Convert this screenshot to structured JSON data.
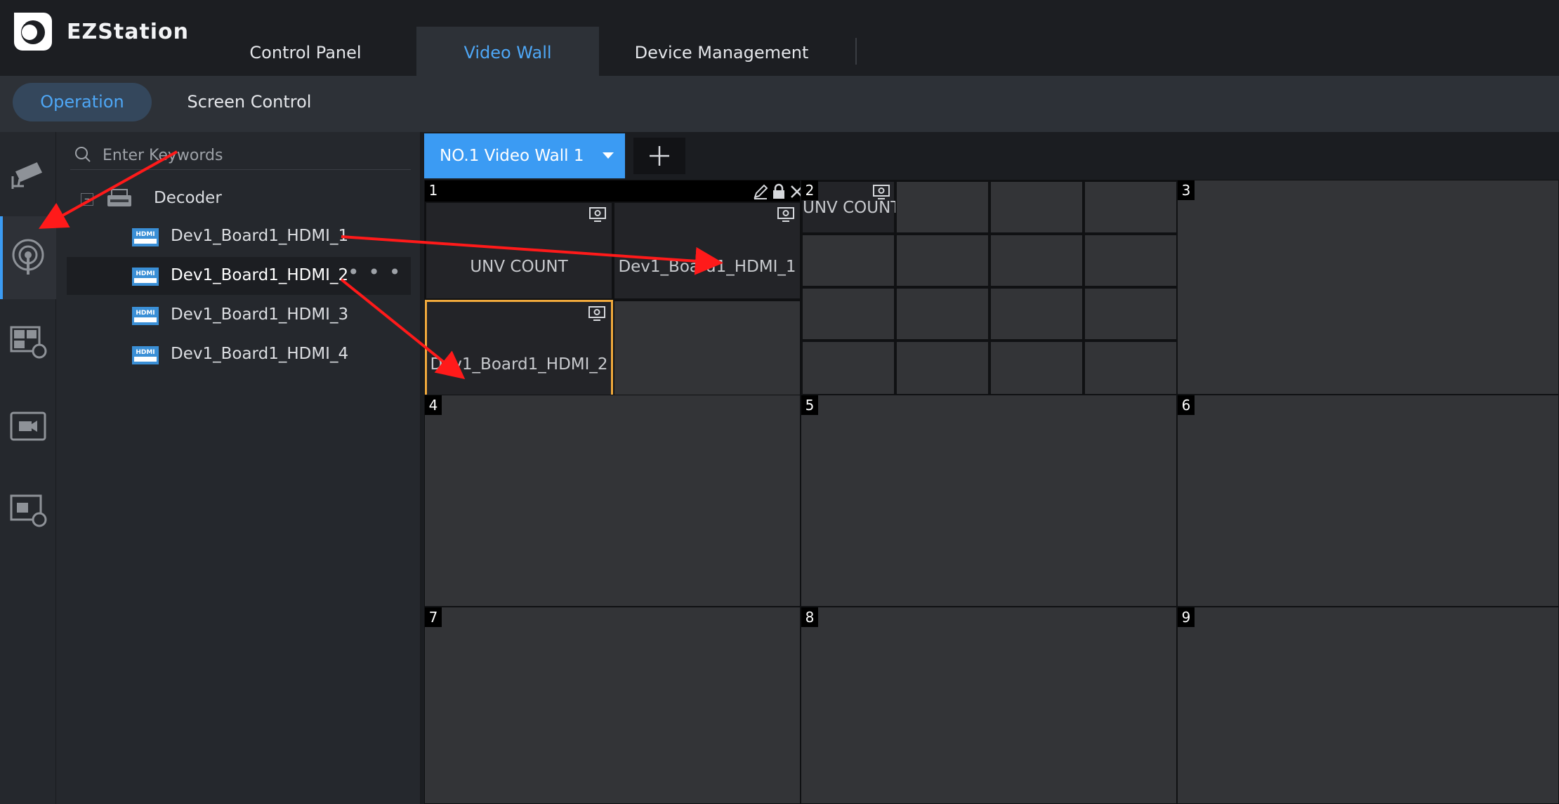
{
  "app": {
    "title": "EZStation"
  },
  "main_tabs": [
    {
      "label": "Control Panel"
    },
    {
      "label": "Video Wall"
    },
    {
      "label": "Device Management"
    }
  ],
  "sub_tabs": [
    {
      "label": "Operation"
    },
    {
      "label": "Screen Control"
    }
  ],
  "search": {
    "placeholder": "Enter Keywords"
  },
  "tree": {
    "root": {
      "label": "Decoder"
    },
    "items": [
      {
        "label": "Dev1_Board1_HDMI_1"
      },
      {
        "label": "Dev1_Board1_HDMI_2"
      },
      {
        "label": "Dev1_Board1_HDMI_3"
      },
      {
        "label": "Dev1_Board1_HDMI_4"
      }
    ],
    "more": "• • •"
  },
  "wall": {
    "tab_label": "NO.1 Video Wall 1",
    "screens": [
      "1",
      "2",
      "3",
      "4",
      "5",
      "6",
      "7",
      "8",
      "9"
    ],
    "windows": {
      "s1_w1": "UNV COUNT",
      "s1_w2": "Dev1_Board1_HDMI_1",
      "s1_w3": "Dev1_Board1_HDMI_2",
      "s2_w1": "UNV COUNT"
    }
  },
  "colors": {
    "accent": "#3b9bf3",
    "selected_border": "#f0a93c",
    "annotation_arrow": "#ff1a1a"
  }
}
